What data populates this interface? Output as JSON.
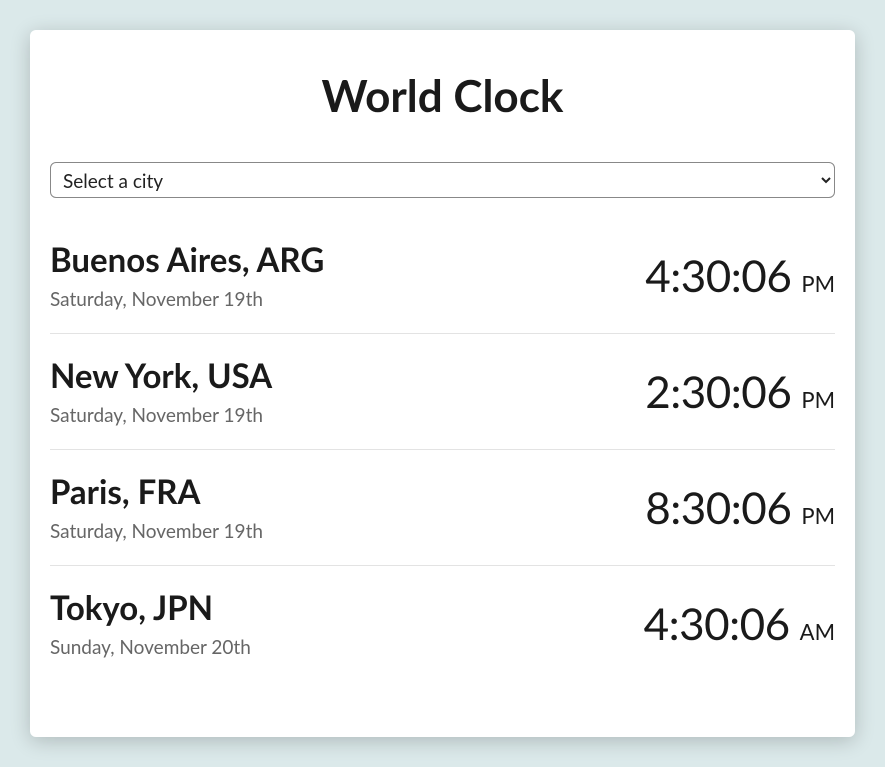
{
  "title": "World Clock",
  "select": {
    "placeholder": "Select a city"
  },
  "clocks": [
    {
      "city": "Buenos Aires, ARG",
      "date": "Saturday, November 19th",
      "time": "4:30:06",
      "ampm": "PM"
    },
    {
      "city": "New York, USA",
      "date": "Saturday, November 19th",
      "time": "2:30:06",
      "ampm": "PM"
    },
    {
      "city": "Paris, FRA",
      "date": "Saturday, November 19th",
      "time": "8:30:06",
      "ampm": "PM"
    },
    {
      "city": "Tokyo, JPN",
      "date": "Sunday, November 20th",
      "time": "4:30:06",
      "ampm": "AM"
    }
  ]
}
